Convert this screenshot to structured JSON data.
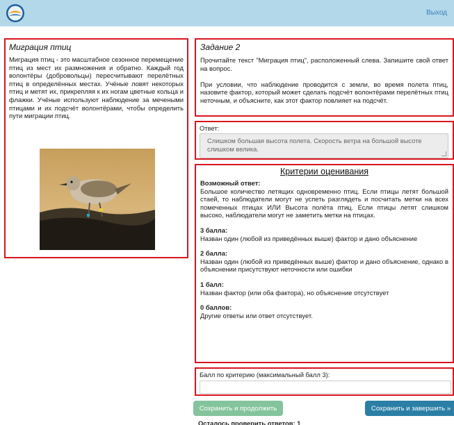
{
  "header": {
    "logout_label": "Выход"
  },
  "article": {
    "title": "Миграция птиц",
    "text": "Миграция птиц - это масштабное сезонное перемещение птиц из мест их размножения и обратно. Каждый год волонтёры (добровольцы) пересчитывают перелётных птиц в определённых местах. Учёные ловят некоторых птиц и метят их, прикрепляя к их ногам цветные кольца и флажки. Учёные используют наблюдение за мечеными птицами и их подсчёт волонтёрами, чтобы определить пути миграции птиц."
  },
  "task": {
    "title": "Задание 2",
    "paragraph1": "Прочитайте текст \"Миграция птиц\", расположенный слева. Запишите свой ответ на вопрос.",
    "paragraph2": "При условии, что наблюдение проводится с земли, во время полета птиц, назовите фактор, который может сделать подсчёт волонтёрами перелётных птиц неточным, и объясните, как этот фактор повлияет на подсчёт."
  },
  "answer": {
    "label": "Ответ:",
    "value": "Слишком большая высота полета. Скорость ветра на большой высоте слишком велика."
  },
  "criteria": {
    "title": "Критерии оценивания",
    "possible_heading": "Возможный ответ:",
    "possible_text": "Большое количество летящих одновременно птиц. Если птицы летят большой стаей, то наблюдатели могут не успеть разглядеть и посчитать метки на всех помеченных птицах ИЛИ Высота полёта птиц. Если птицы летят слишком высоко, наблюдатели могут не заметить метки на птицах.",
    "levels": [
      {
        "heading": "3 балла:",
        "text": "Назван один (любой из приведённых выше) фактор и дано объяснение"
      },
      {
        "heading": "2 балла:",
        "text": "Назван один (любой из приведённых выше) фактор и дано объяснение, однако в объяснении присутствуют неточности или ошибки"
      },
      {
        "heading": "1 балл:",
        "text": "Назван фактор (или оба фактора), но объяснение отсутствует"
      },
      {
        "heading": "0 баллов:",
        "text": "Другие ответы или ответ отсутствует."
      }
    ]
  },
  "score": {
    "label": "Балл по критерию (максимальный балл 3):",
    "value": ""
  },
  "buttons": {
    "save_continue": "Сохранить и продолжить",
    "save_finish": "Сохранить и завершить »"
  },
  "footer": {
    "remaining": "Осталось проверить ответов: 1"
  },
  "colors": {
    "topbar": "#b3d8ea",
    "panel_border": "#d9141c",
    "save_button": "#84c49c",
    "finish_button": "#2b7fa6"
  }
}
